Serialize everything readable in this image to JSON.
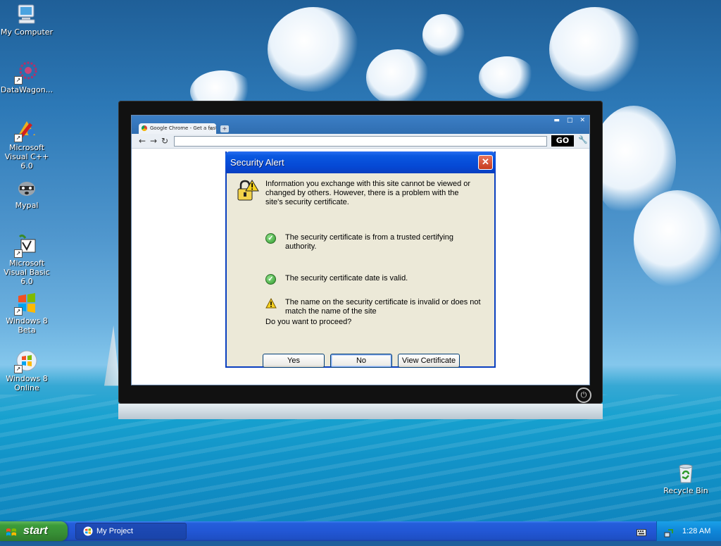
{
  "desktop": {
    "icons": [
      {
        "label": "My Computer",
        "icon": "my-computer-icon"
      },
      {
        "label": "DataWagon...",
        "icon": "datawagon-icon"
      },
      {
        "label": "Microsoft Visual C++ 6.0",
        "icon": "visual-cpp-icon"
      },
      {
        "label": "Mypal",
        "icon": "mypal-icon"
      },
      {
        "label": "Microsoft Visual Basic 6.0",
        "icon": "visual-basic-icon"
      },
      {
        "label": "Windows 8 Beta",
        "icon": "windows-logo-icon"
      },
      {
        "label": "Windows 8 Online",
        "icon": "windows-orb-icon"
      }
    ],
    "recycle_bin": {
      "label": "Recycle Bin",
      "icon": "recycle-bin-icon"
    }
  },
  "browser": {
    "tab_title": "Google Chrome - Get a fast",
    "go_label": "GO",
    "address_value": ""
  },
  "dialog": {
    "title": "Security Alert",
    "intro": "Information you exchange with this site cannot be viewed or changed by others. However, there is a problem with the site's security certificate.",
    "checks": [
      {
        "status": "ok",
        "text": "The security certificate is from a trusted certifying authority."
      },
      {
        "status": "ok",
        "text": "The security certificate date is valid."
      },
      {
        "status": "warning",
        "text": "The name on the security certificate is invalid or does not match the name of the site"
      }
    ],
    "question": "Do you want to proceed?",
    "buttons": {
      "yes": "Yes",
      "no": "No",
      "view_certificate": "View Certificate"
    }
  },
  "taskbar": {
    "start_label": "start",
    "tasks": [
      {
        "label": "My Project"
      }
    ],
    "clock": "1:28 AM"
  },
  "colors": {
    "taskbar_blue": "#245edb",
    "start_green": "#3c9c3a",
    "dialog_title_blue": "#0548d4",
    "dialog_bg": "#ece9d8"
  }
}
